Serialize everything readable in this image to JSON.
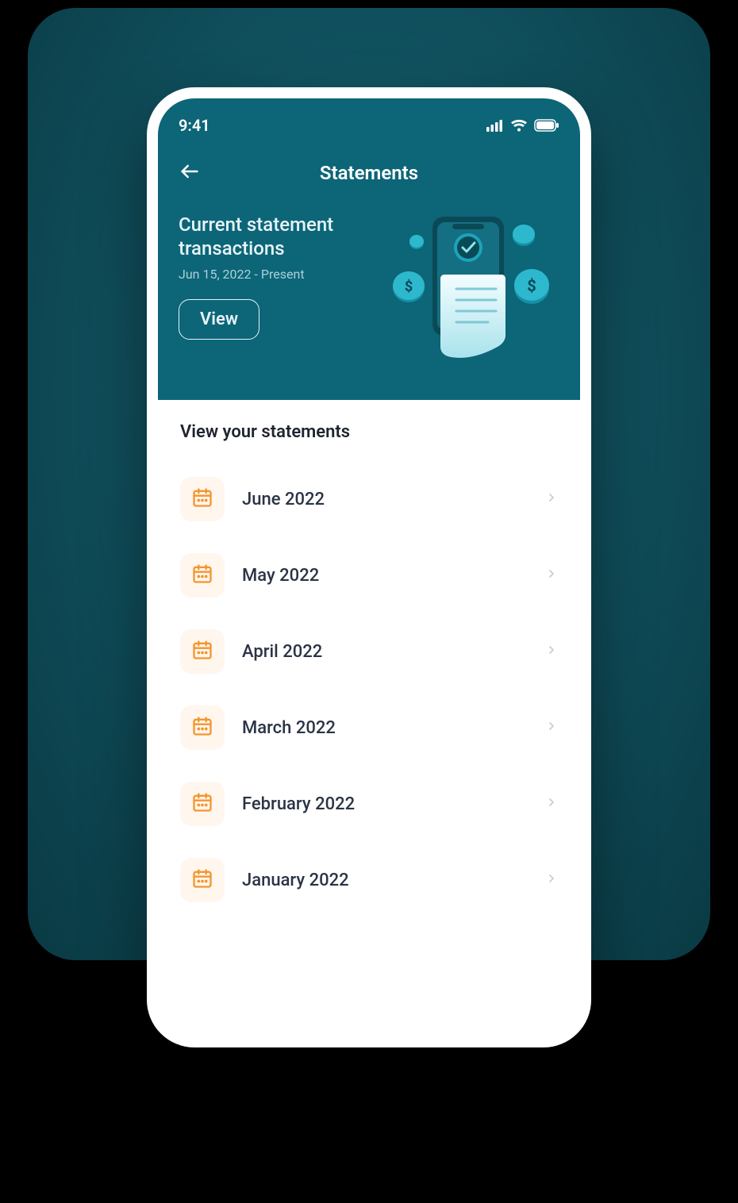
{
  "status": {
    "time": "9:41"
  },
  "nav": {
    "title": "Statements"
  },
  "current": {
    "title_line1": "Current statement",
    "title_line2": "transactions",
    "range": "Jun 15, 2022 - Present",
    "view_label": "View"
  },
  "section_title": "View your statements",
  "statements": [
    {
      "label": "June 2022"
    },
    {
      "label": "May 2022"
    },
    {
      "label": "April 2022"
    },
    {
      "label": "March 2022"
    },
    {
      "label": "February 2022"
    },
    {
      "label": "January 2022"
    }
  ],
  "colors": {
    "teal": "#0d6578",
    "icon_orange": "#f5952c",
    "icon_bg": "#fff6ee"
  }
}
